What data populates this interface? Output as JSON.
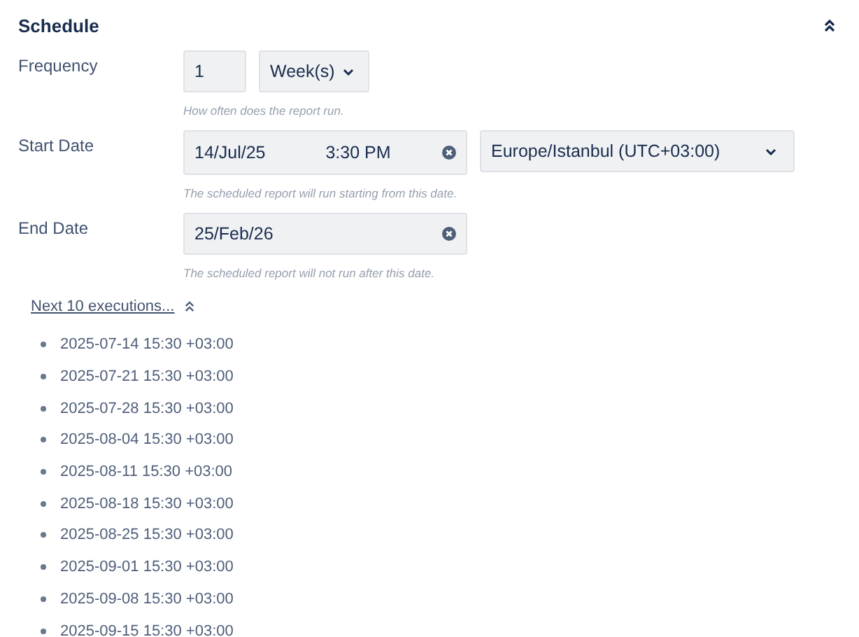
{
  "section": {
    "title": "Schedule"
  },
  "frequency": {
    "label": "Frequency",
    "count": "1",
    "unit": "Week(s)",
    "hint": "How often does the report run."
  },
  "start_date": {
    "label": "Start Date",
    "date": "14/Jul/25",
    "time": "3:30 PM",
    "timezone": "Europe/Istanbul (UTC+03:00)",
    "hint": "The scheduled report will run starting from this date."
  },
  "end_date": {
    "label": "End Date",
    "date": "25/Feb/26",
    "hint": "The scheduled report will not run after this date."
  },
  "executions": {
    "link": "Next 10 executions...",
    "items": [
      "2025-07-14 15:30 +03:00",
      "2025-07-21 15:30 +03:00",
      "2025-07-28 15:30 +03:00",
      "2025-08-04 15:30 +03:00",
      "2025-08-11 15:30 +03:00",
      "2025-08-18 15:30 +03:00",
      "2025-08-25 15:30 +03:00",
      "2025-09-01 15:30 +03:00",
      "2025-09-08 15:30 +03:00",
      "2025-09-15 15:30 +03:00"
    ]
  }
}
